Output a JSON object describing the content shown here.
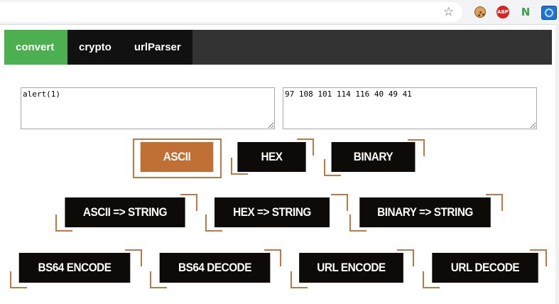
{
  "tabs": [
    {
      "label": "convert",
      "active": true
    },
    {
      "label": "crypto",
      "active": false
    },
    {
      "label": "urlParser",
      "active": false
    }
  ],
  "input": {
    "value": "alert(1)"
  },
  "output": {
    "value": "97 108 101 114 116 40 49 41"
  },
  "buttons": {
    "ascii": "ASCII",
    "hex": "HEX",
    "binary": "BINARY",
    "ascii_to_string": "ASCII => STRING",
    "hex_to_string": "HEX => STRING",
    "binary_to_string": "BINARY => STRING",
    "bs64_encode": "BS64 ENCODE",
    "bs64_decode": "BS64 DECODE",
    "url_encode": "URL ENCODE",
    "url_decode": "URL DECODE"
  },
  "colors": {
    "active_tab": "#4caf50",
    "active_button": "#c06f35",
    "button": "#0d0a08",
    "accent_corner": "#b97a47"
  }
}
